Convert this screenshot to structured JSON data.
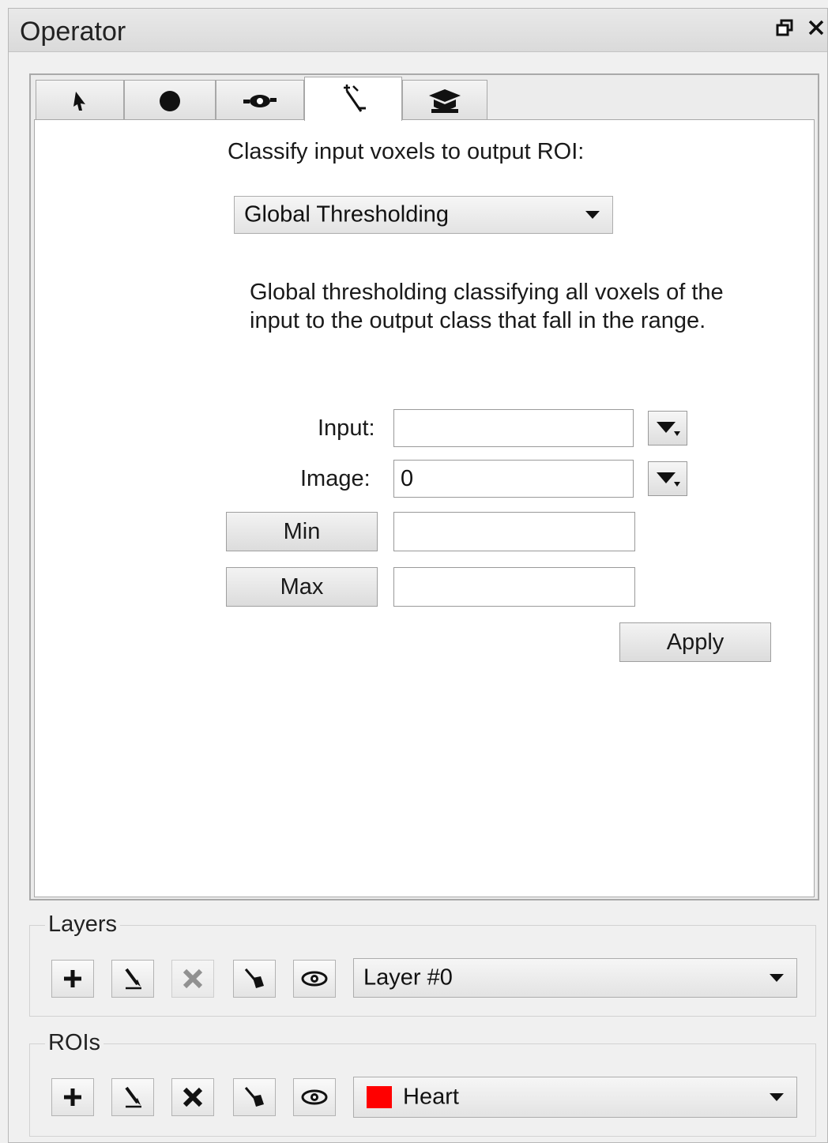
{
  "window": {
    "title": "Operator",
    "float_icon": "restore-window-icon",
    "close_icon": "close-icon"
  },
  "tabs": [
    {
      "icon": "pointer-arrow-icon",
      "active": false
    },
    {
      "icon": "filled-circle-icon",
      "active": false
    },
    {
      "icon": "eye-tool-icon",
      "active": false
    },
    {
      "icon": "magic-wand-icon",
      "active": true
    },
    {
      "icon": "graduation-cap-icon",
      "active": false
    }
  ],
  "classify": {
    "heading": "Classify input voxels to output ROI:",
    "method_selected": "Global Thresholding",
    "description": "Global thresholding classifying all voxels of the input to the output class that fall in the range."
  },
  "form": {
    "input_label": "Input:",
    "input_value": "",
    "image_label": "Image:",
    "image_value": "0",
    "min_button": "Min",
    "min_value": "",
    "max_button": "Max",
    "max_value": "",
    "apply_button": "Apply"
  },
  "layers": {
    "title": "Layers",
    "selected": "Layer #0",
    "buttons": [
      "add-icon",
      "edit-pencil-icon",
      "delete-icon",
      "brush-icon",
      "eye-icon"
    ]
  },
  "rois": {
    "title": "ROIs",
    "selected": "Heart",
    "selected_color": "#ff0000",
    "buttons": [
      "add-icon",
      "edit-pencil-icon",
      "delete-icon",
      "brush-icon",
      "eye-icon"
    ]
  }
}
